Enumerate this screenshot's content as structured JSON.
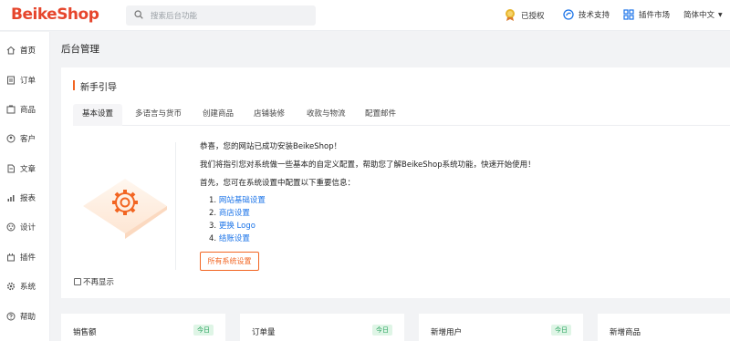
{
  "header": {
    "logo": "BeikeShop",
    "search_placeholder": "搜索后台功能",
    "authorized": "已授权",
    "tech_support": "技术支持",
    "plugin_market": "插件市场",
    "language": "简体中文",
    "colors": {
      "brand": "#e6452c",
      "accent": "#f26522"
    }
  },
  "sidebar": {
    "items": [
      {
        "label": "首页",
        "icon": "home-icon"
      },
      {
        "label": "订单",
        "icon": "order-icon"
      },
      {
        "label": "商品",
        "icon": "product-icon"
      },
      {
        "label": "客户",
        "icon": "customer-icon"
      },
      {
        "label": "文章",
        "icon": "article-icon"
      },
      {
        "label": "报表",
        "icon": "report-icon"
      },
      {
        "label": "设计",
        "icon": "design-icon"
      },
      {
        "label": "插件",
        "icon": "plugin-icon"
      },
      {
        "label": "系统",
        "icon": "system-icon"
      },
      {
        "label": "帮助",
        "icon": "help-icon"
      }
    ]
  },
  "main": {
    "page_title": "后台管理",
    "guide": {
      "title": "新手引导",
      "tabs": [
        "基本设置",
        "多语言与货币",
        "创建商品",
        "店铺装修",
        "收款与物流",
        "配置邮件"
      ],
      "active_tab": "基本设置",
      "line1": "恭喜，您的网站已成功安装BeikeShop！",
      "line2": "我们将指引您对系统做一些基本的自定义配置，帮助您了解BeikeShop系统功能，快速开始使用！",
      "line3": "首先，您可在系统设置中配置以下重要信息：",
      "steps": [
        {
          "num": "1.",
          "label": "网站基础设置"
        },
        {
          "num": "2.",
          "label": "商店设置"
        },
        {
          "num": "3.",
          "label": "更换 Logo"
        },
        {
          "num": "4.",
          "label": "结账设置"
        }
      ],
      "all_settings_button": "所有系统设置",
      "no_show_again": "不再显示"
    },
    "stats": [
      {
        "label": "销售额",
        "badge": "今日"
      },
      {
        "label": "订单量",
        "badge": "今日"
      },
      {
        "label": "新增用户",
        "badge": "今日"
      },
      {
        "label": "新增商品",
        "badge": ""
      }
    ]
  }
}
